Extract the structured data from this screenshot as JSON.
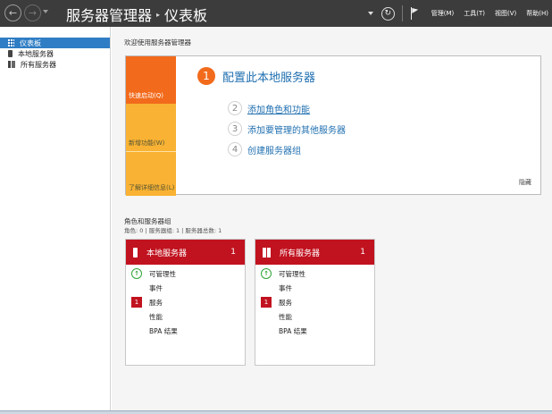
{
  "title_bar": {
    "title": "服务器管理器",
    "separator": "▸",
    "page": "仪表板",
    "menus": [
      "管理(M)",
      "工具(T)",
      "视图(V)",
      "帮助(H)"
    ]
  },
  "sidebar": {
    "items": [
      {
        "label": "仪表板",
        "icon": "dashboard-grid-icon",
        "active": true
      },
      {
        "label": "本地服务器",
        "icon": "server-icon",
        "active": false
      },
      {
        "label": "所有服务器",
        "icon": "servers-icon",
        "active": false
      }
    ]
  },
  "main": {
    "welcome_label": "欢迎使用服务器管理器",
    "quick_start": {
      "tabs": [
        "快速启动(Q)",
        "新增功能(W)",
        "了解详细信息(L)"
      ],
      "steps": [
        {
          "num": "1",
          "text": "配置此本地服务器"
        },
        {
          "num": "2",
          "text": "添加角色和功能"
        },
        {
          "num": "3",
          "text": "添加要管理的其他服务器"
        },
        {
          "num": "4",
          "text": "创建服务器组"
        }
      ],
      "hide_label": "隐藏"
    },
    "roles": {
      "title": "角色和服务器组",
      "subtitle": "角色: 0 | 服务器组: 1 | 服务器总数: 1",
      "cards": [
        {
          "name": "本地服务器",
          "count": "1",
          "rows": [
            {
              "label": "可管理性",
              "status": "ok"
            },
            {
              "label": "事件",
              "status": "none"
            },
            {
              "label": "服务",
              "status": "alert",
              "badge": "1"
            },
            {
              "label": "性能",
              "status": "none"
            },
            {
              "label": "BPA 结果",
              "status": "none"
            }
          ]
        },
        {
          "name": "所有服务器",
          "count": "1",
          "rows": [
            {
              "label": "可管理性",
              "status": "ok"
            },
            {
              "label": "事件",
              "status": "none"
            },
            {
              "label": "服务",
              "status": "alert",
              "badge": "1"
            },
            {
              "label": "性能",
              "status": "none"
            },
            {
              "label": "BPA 结果",
              "status": "none"
            }
          ]
        }
      ]
    }
  },
  "colors": {
    "titlebar": "#3c3c3c",
    "accent_blue": "#2f7dc4",
    "orange": "#f26a1b",
    "yellow": "#f9b233",
    "card_red": "#c1121f",
    "ok_green": "#2fa53a"
  }
}
